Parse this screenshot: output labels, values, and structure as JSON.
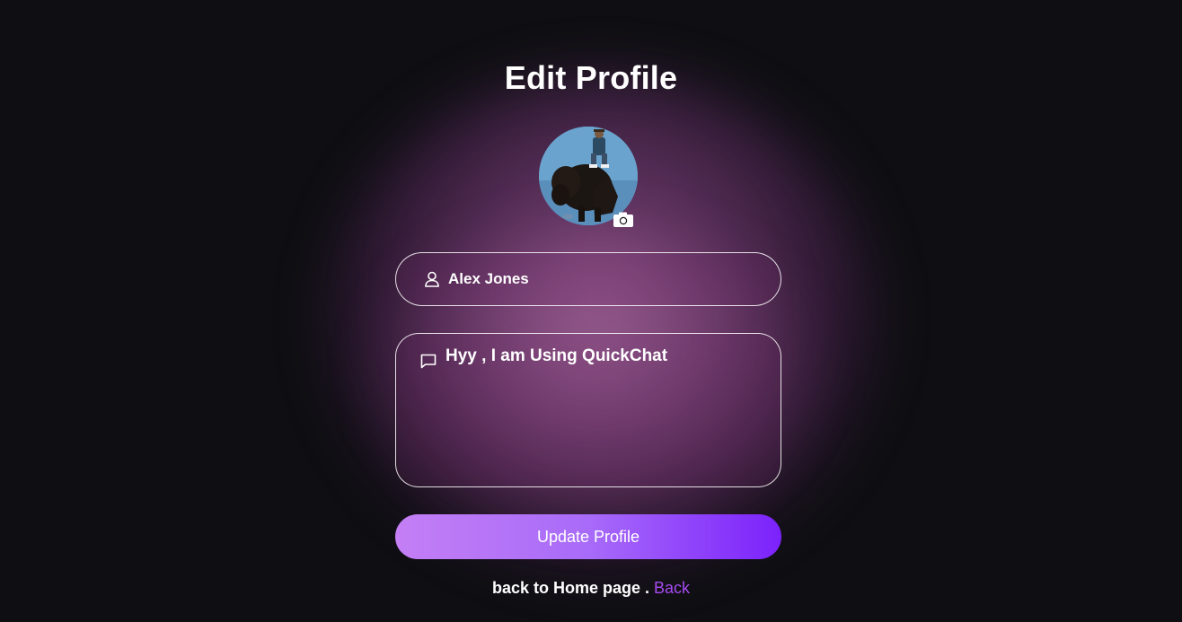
{
  "page": {
    "title": "Edit Profile"
  },
  "avatar": {
    "image": "profile-photo-rider-on-bison",
    "camera_icon": "camera-icon"
  },
  "form": {
    "name": {
      "icon": "user-icon",
      "value": "Alex Jones"
    },
    "bio": {
      "icon": "message-square-icon",
      "value": "Hyy , I am Using QuickChat"
    },
    "submit_label": "Update Profile"
  },
  "footer": {
    "text": "back to Home page .",
    "link_label": "Back"
  },
  "colors": {
    "background": "#0f0f13",
    "glow": "#8a3f86",
    "button_start": "#c47ff5",
    "button_end": "#7b22fb",
    "link": "#a74bf0"
  }
}
